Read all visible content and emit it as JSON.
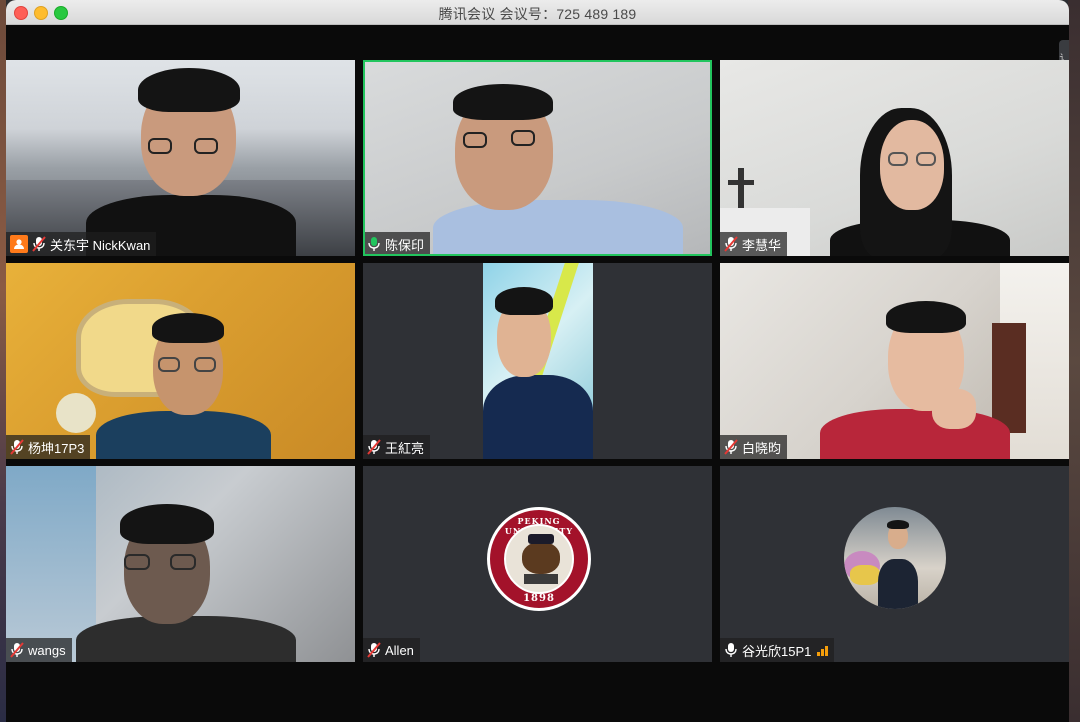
{
  "window": {
    "title": "腾讯会议 会议号：725 489 189",
    "side_tab_label": "讠"
  },
  "colors": {
    "accent_active_speaker": "#22c55e",
    "host_badge": "#ff7a1a",
    "muted_mic": "#ffffff",
    "signal_bars": "#f59e0b"
  },
  "participants": [
    {
      "name": "关东宇 NickKwan",
      "host": true,
      "mic": "muted",
      "active_speaker": false
    },
    {
      "name": "陈保印",
      "host": false,
      "mic": "on",
      "active_speaker": true
    },
    {
      "name": "李慧华",
      "host": false,
      "mic": "muted",
      "active_speaker": false
    },
    {
      "name": "杨坤17P3",
      "host": false,
      "mic": "muted",
      "active_speaker": false
    },
    {
      "name": "王紅亮",
      "host": false,
      "mic": "muted",
      "active_speaker": false
    },
    {
      "name": "白晓昀",
      "host": false,
      "mic": "muted",
      "active_speaker": false
    },
    {
      "name": "wangs",
      "host": false,
      "mic": "muted",
      "active_speaker": false
    },
    {
      "name": "Allen",
      "host": false,
      "mic": "muted",
      "active_speaker": false
    },
    {
      "name": "谷光欣15P1",
      "host": false,
      "mic": "on",
      "active_speaker": false,
      "signal": true
    }
  ],
  "logo": {
    "top_text": "PEKING UNIVERSITY",
    "bottom_text": "1898"
  }
}
